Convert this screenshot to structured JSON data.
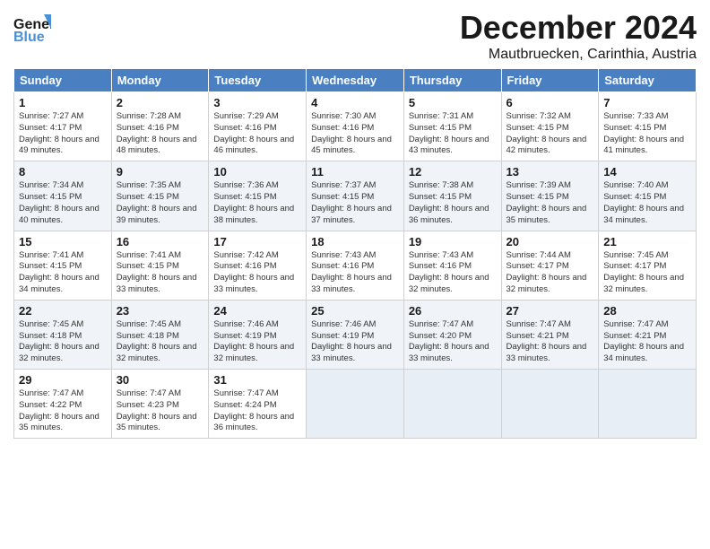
{
  "header": {
    "logo_line1": "General",
    "logo_line2": "Blue",
    "title": "December 2024",
    "subtitle": "Mautbruecken, Carinthia, Austria"
  },
  "days_of_week": [
    "Sunday",
    "Monday",
    "Tuesday",
    "Wednesday",
    "Thursday",
    "Friday",
    "Saturday"
  ],
  "weeks": [
    [
      {
        "day": 1,
        "sunrise": "7:27 AM",
        "sunset": "4:17 PM",
        "daylight": "8 hours and 49 minutes."
      },
      {
        "day": 2,
        "sunrise": "7:28 AM",
        "sunset": "4:16 PM",
        "daylight": "8 hours and 48 minutes."
      },
      {
        "day": 3,
        "sunrise": "7:29 AM",
        "sunset": "4:16 PM",
        "daylight": "8 hours and 46 minutes."
      },
      {
        "day": 4,
        "sunrise": "7:30 AM",
        "sunset": "4:16 PM",
        "daylight": "8 hours and 45 minutes."
      },
      {
        "day": 5,
        "sunrise": "7:31 AM",
        "sunset": "4:15 PM",
        "daylight": "8 hours and 43 minutes."
      },
      {
        "day": 6,
        "sunrise": "7:32 AM",
        "sunset": "4:15 PM",
        "daylight": "8 hours and 42 minutes."
      },
      {
        "day": 7,
        "sunrise": "7:33 AM",
        "sunset": "4:15 PM",
        "daylight": "8 hours and 41 minutes."
      }
    ],
    [
      {
        "day": 8,
        "sunrise": "7:34 AM",
        "sunset": "4:15 PM",
        "daylight": "8 hours and 40 minutes."
      },
      {
        "day": 9,
        "sunrise": "7:35 AM",
        "sunset": "4:15 PM",
        "daylight": "8 hours and 39 minutes."
      },
      {
        "day": 10,
        "sunrise": "7:36 AM",
        "sunset": "4:15 PM",
        "daylight": "8 hours and 38 minutes."
      },
      {
        "day": 11,
        "sunrise": "7:37 AM",
        "sunset": "4:15 PM",
        "daylight": "8 hours and 37 minutes."
      },
      {
        "day": 12,
        "sunrise": "7:38 AM",
        "sunset": "4:15 PM",
        "daylight": "8 hours and 36 minutes."
      },
      {
        "day": 13,
        "sunrise": "7:39 AM",
        "sunset": "4:15 PM",
        "daylight": "8 hours and 35 minutes."
      },
      {
        "day": 14,
        "sunrise": "7:40 AM",
        "sunset": "4:15 PM",
        "daylight": "8 hours and 34 minutes."
      }
    ],
    [
      {
        "day": 15,
        "sunrise": "7:41 AM",
        "sunset": "4:15 PM",
        "daylight": "8 hours and 34 minutes."
      },
      {
        "day": 16,
        "sunrise": "7:41 AM",
        "sunset": "4:15 PM",
        "daylight": "8 hours and 33 minutes."
      },
      {
        "day": 17,
        "sunrise": "7:42 AM",
        "sunset": "4:16 PM",
        "daylight": "8 hours and 33 minutes."
      },
      {
        "day": 18,
        "sunrise": "7:43 AM",
        "sunset": "4:16 PM",
        "daylight": "8 hours and 33 minutes."
      },
      {
        "day": 19,
        "sunrise": "7:43 AM",
        "sunset": "4:16 PM",
        "daylight": "8 hours and 32 minutes."
      },
      {
        "day": 20,
        "sunrise": "7:44 AM",
        "sunset": "4:17 PM",
        "daylight": "8 hours and 32 minutes."
      },
      {
        "day": 21,
        "sunrise": "7:45 AM",
        "sunset": "4:17 PM",
        "daylight": "8 hours and 32 minutes."
      }
    ],
    [
      {
        "day": 22,
        "sunrise": "7:45 AM",
        "sunset": "4:18 PM",
        "daylight": "8 hours and 32 minutes."
      },
      {
        "day": 23,
        "sunrise": "7:45 AM",
        "sunset": "4:18 PM",
        "daylight": "8 hours and 32 minutes."
      },
      {
        "day": 24,
        "sunrise": "7:46 AM",
        "sunset": "4:19 PM",
        "daylight": "8 hours and 32 minutes."
      },
      {
        "day": 25,
        "sunrise": "7:46 AM",
        "sunset": "4:19 PM",
        "daylight": "8 hours and 33 minutes."
      },
      {
        "day": 26,
        "sunrise": "7:47 AM",
        "sunset": "4:20 PM",
        "daylight": "8 hours and 33 minutes."
      },
      {
        "day": 27,
        "sunrise": "7:47 AM",
        "sunset": "4:21 PM",
        "daylight": "8 hours and 33 minutes."
      },
      {
        "day": 28,
        "sunrise": "7:47 AM",
        "sunset": "4:21 PM",
        "daylight": "8 hours and 34 minutes."
      }
    ],
    [
      {
        "day": 29,
        "sunrise": "7:47 AM",
        "sunset": "4:22 PM",
        "daylight": "8 hours and 35 minutes."
      },
      {
        "day": 30,
        "sunrise": "7:47 AM",
        "sunset": "4:23 PM",
        "daylight": "8 hours and 35 minutes."
      },
      {
        "day": 31,
        "sunrise": "7:47 AM",
        "sunset": "4:24 PM",
        "daylight": "8 hours and 36 minutes."
      },
      null,
      null,
      null,
      null
    ]
  ]
}
